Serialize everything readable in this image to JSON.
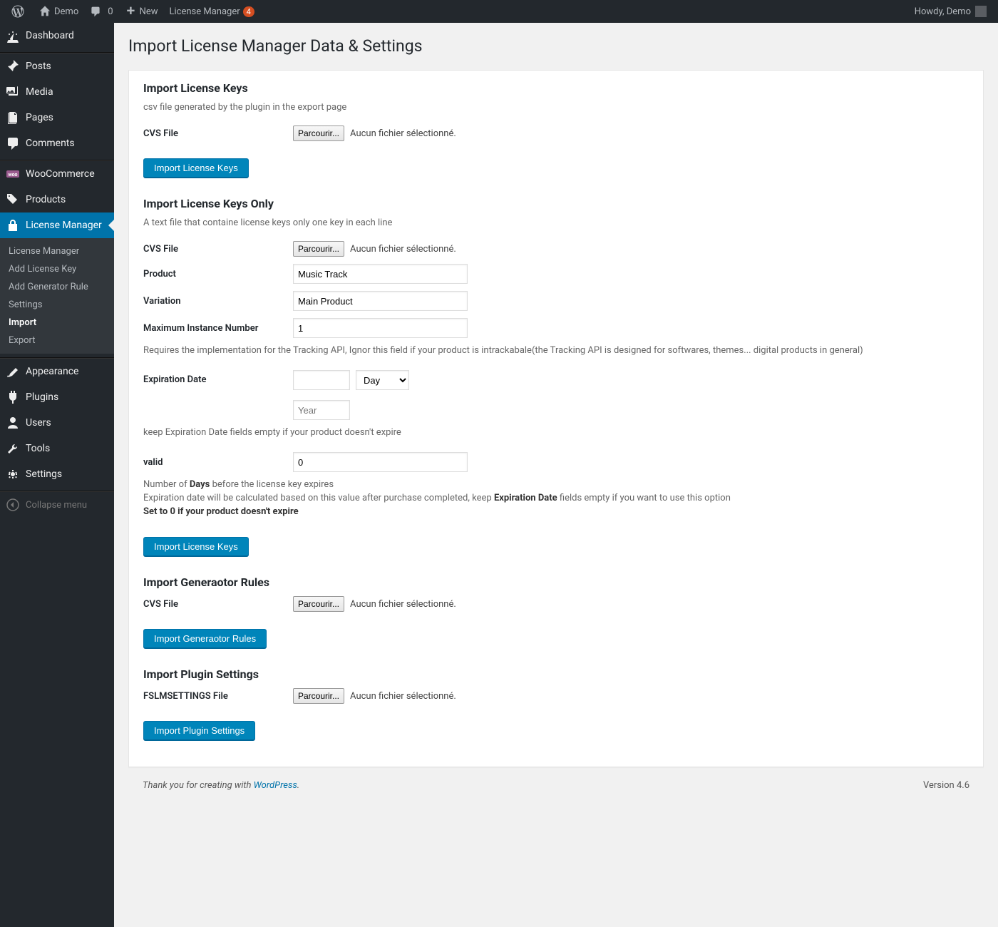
{
  "adminbar": {
    "site": "Demo",
    "comments": "0",
    "new": "New",
    "lm": "License Manager",
    "lm_badge": "4",
    "greeting": "Howdy, Demo"
  },
  "sidebar": {
    "items": [
      {
        "label": "Dashboard"
      },
      {
        "label": "Posts"
      },
      {
        "label": "Media"
      },
      {
        "label": "Pages"
      },
      {
        "label": "Comments"
      },
      {
        "label": "WooCommerce"
      },
      {
        "label": "Products"
      },
      {
        "label": "License Manager"
      },
      {
        "label": "Appearance"
      },
      {
        "label": "Plugins"
      },
      {
        "label": "Users"
      },
      {
        "label": "Tools"
      },
      {
        "label": "Settings"
      }
    ],
    "submenu": [
      {
        "label": "License Manager"
      },
      {
        "label": "Add License Key"
      },
      {
        "label": "Add Generator Rule"
      },
      {
        "label": "Settings"
      },
      {
        "label": "Import"
      },
      {
        "label": "Export"
      }
    ],
    "collapse": "Collapse menu"
  },
  "page": {
    "title": "Import License Manager Data & Settings"
  },
  "sec1": {
    "heading": "Import License Keys",
    "desc": "csv file generated by the plugin in the export page",
    "cvs_label": "CVS File",
    "browse": "Parcourir...",
    "nofile": "Aucun fichier sélectionné.",
    "button": "Import License Keys"
  },
  "sec2": {
    "heading": "Import License Keys Only",
    "desc": "A text file that containe license keys only one key in each line",
    "cvs_label": "CVS File",
    "browse": "Parcourir...",
    "nofile": "Aucun fichier sélectionné.",
    "product_label": "Product",
    "product_value": "Music Track",
    "variation_label": "Variation",
    "variation_value": "Main Product",
    "maxinst_label": "Maximum Instance Number",
    "maxinst_value": "1",
    "maxinst_hint": "Requires the implementation for the Tracking API, Ignor this field if your product is intrackabale(the Tracking API is designed for softwares, themes... digital products in general)",
    "exp_label": "Expiration Date",
    "exp_day": "Day",
    "exp_year_placeholder": "Year",
    "exp_hint": "keep Expiration Date fields empty if your product doesn't expire",
    "valid_label": "valid",
    "valid_value": "0",
    "valid_hint_prefix": "Number of ",
    "valid_hint_days": "Days",
    "valid_hint_suffix": " before the license key expires",
    "valid_hint2_prefix": "Expiration date will be calculated based on this value after purchase completed, keep ",
    "valid_hint2_bold": "Expiration Date",
    "valid_hint2_suffix": " fields empty if you want to use this option",
    "valid_hint3": "Set to 0 if your product doesn't expire",
    "button": "Import License Keys"
  },
  "sec3": {
    "heading": "Import Generaotor Rules",
    "cvs_label": "CVS File",
    "browse": "Parcourir...",
    "nofile": "Aucun fichier sélectionné.",
    "button": "Import Generaotor Rules"
  },
  "sec4": {
    "heading": "Import Plugin Settings",
    "file_label": "FSLMSETTINGS File",
    "browse": "Parcourir...",
    "nofile": "Aucun fichier sélectionné.",
    "button": "Import Plugin Settings"
  },
  "footer": {
    "thanks_prefix": "Thank you for creating with ",
    "thanks_link": "WordPress",
    "thanks_suffix": ".",
    "version": "Version 4.6"
  }
}
